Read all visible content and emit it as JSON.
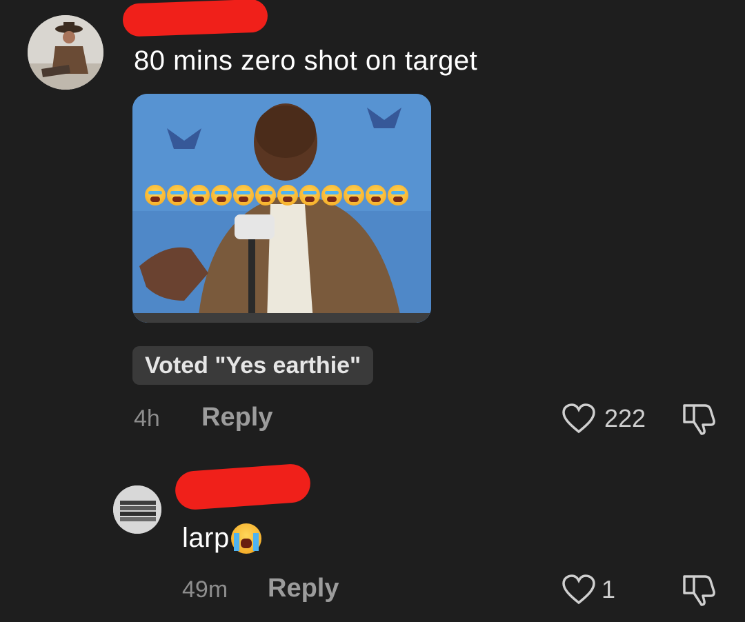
{
  "comments": [
    {
      "text": "80 mins zero shot on target",
      "vote": "Voted \"Yes earthie\"",
      "time": "4h",
      "reply_label": "Reply",
      "likes": "222",
      "avatar_icon": "cowboy-avatar"
    },
    {
      "text": "larp",
      "time": "49m",
      "reply_label": "Reply",
      "likes": "1",
      "avatar_icon": "books-avatar"
    }
  ],
  "icons": {
    "like": "heart-icon",
    "dislike": "thumbs-down-icon",
    "emoji": "loudly-crying-face"
  },
  "colors": {
    "background": "#1e1e1e",
    "redaction": "#f0201a",
    "secondary_text": "#8e8e8e"
  }
}
